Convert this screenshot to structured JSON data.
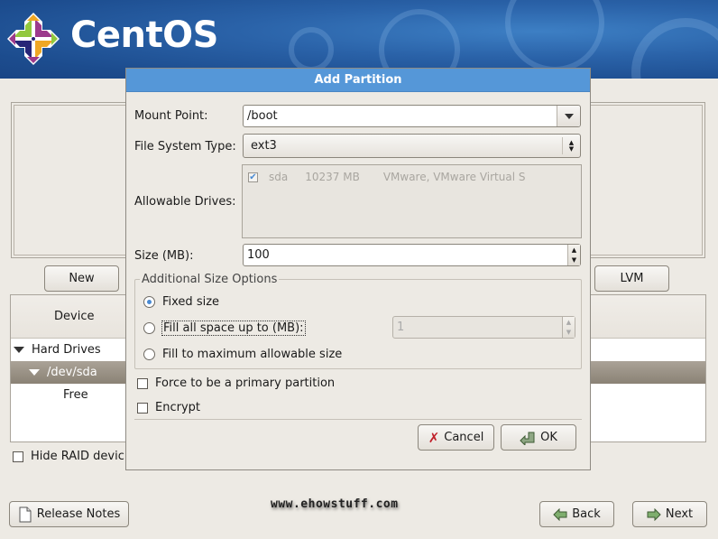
{
  "banner": {
    "brand": "CentOS",
    "logo_icon": "centos-logo-icon"
  },
  "main": {
    "buttons": {
      "new": "New",
      "new_mnemonic_index": 2,
      "lvm": "LVM"
    },
    "tree": {
      "column_header": "Device",
      "rows": [
        {
          "label": "Hard Drives",
          "expanded": true,
          "level": 0,
          "selected": false
        },
        {
          "label": "/dev/sda",
          "expanded": true,
          "level": 1,
          "selected": true
        },
        {
          "label": "Free",
          "level": 2,
          "selected": false
        }
      ]
    },
    "hide_raid": {
      "label": "Hide RAID devic",
      "checked": false
    }
  },
  "dialog": {
    "title": "Add Partition",
    "mount_point": {
      "label": "Mount Point:",
      "value": "/boot"
    },
    "fs_type": {
      "label": "File System Type:",
      "value": "ext3"
    },
    "allowable_drives": {
      "label": "Allowable Drives:",
      "drives": [
        {
          "checked": true,
          "name": "sda",
          "size": "10237 MB",
          "model": "VMware, VMware Virtual S"
        }
      ]
    },
    "size": {
      "label": "Size (MB):",
      "value": "100"
    },
    "additional": {
      "legend": "Additional Size Options",
      "options": [
        {
          "label": "Fixed size",
          "selected": true
        },
        {
          "label": "Fill all space up to (MB):",
          "selected": false
        },
        {
          "label": "Fill to maximum allowable size",
          "selected": false
        }
      ],
      "fill_up_to_value": "1"
    },
    "force_primary": {
      "label": "Force to be a primary partition",
      "checked": false
    },
    "encrypt": {
      "label": "Encrypt",
      "checked": false
    },
    "cancel_label": "Cancel",
    "ok_label": "OK"
  },
  "footer": {
    "release_notes": "Release Notes",
    "watermark": "www.ehowstuff.com",
    "back": "Back",
    "next": "Next"
  }
}
